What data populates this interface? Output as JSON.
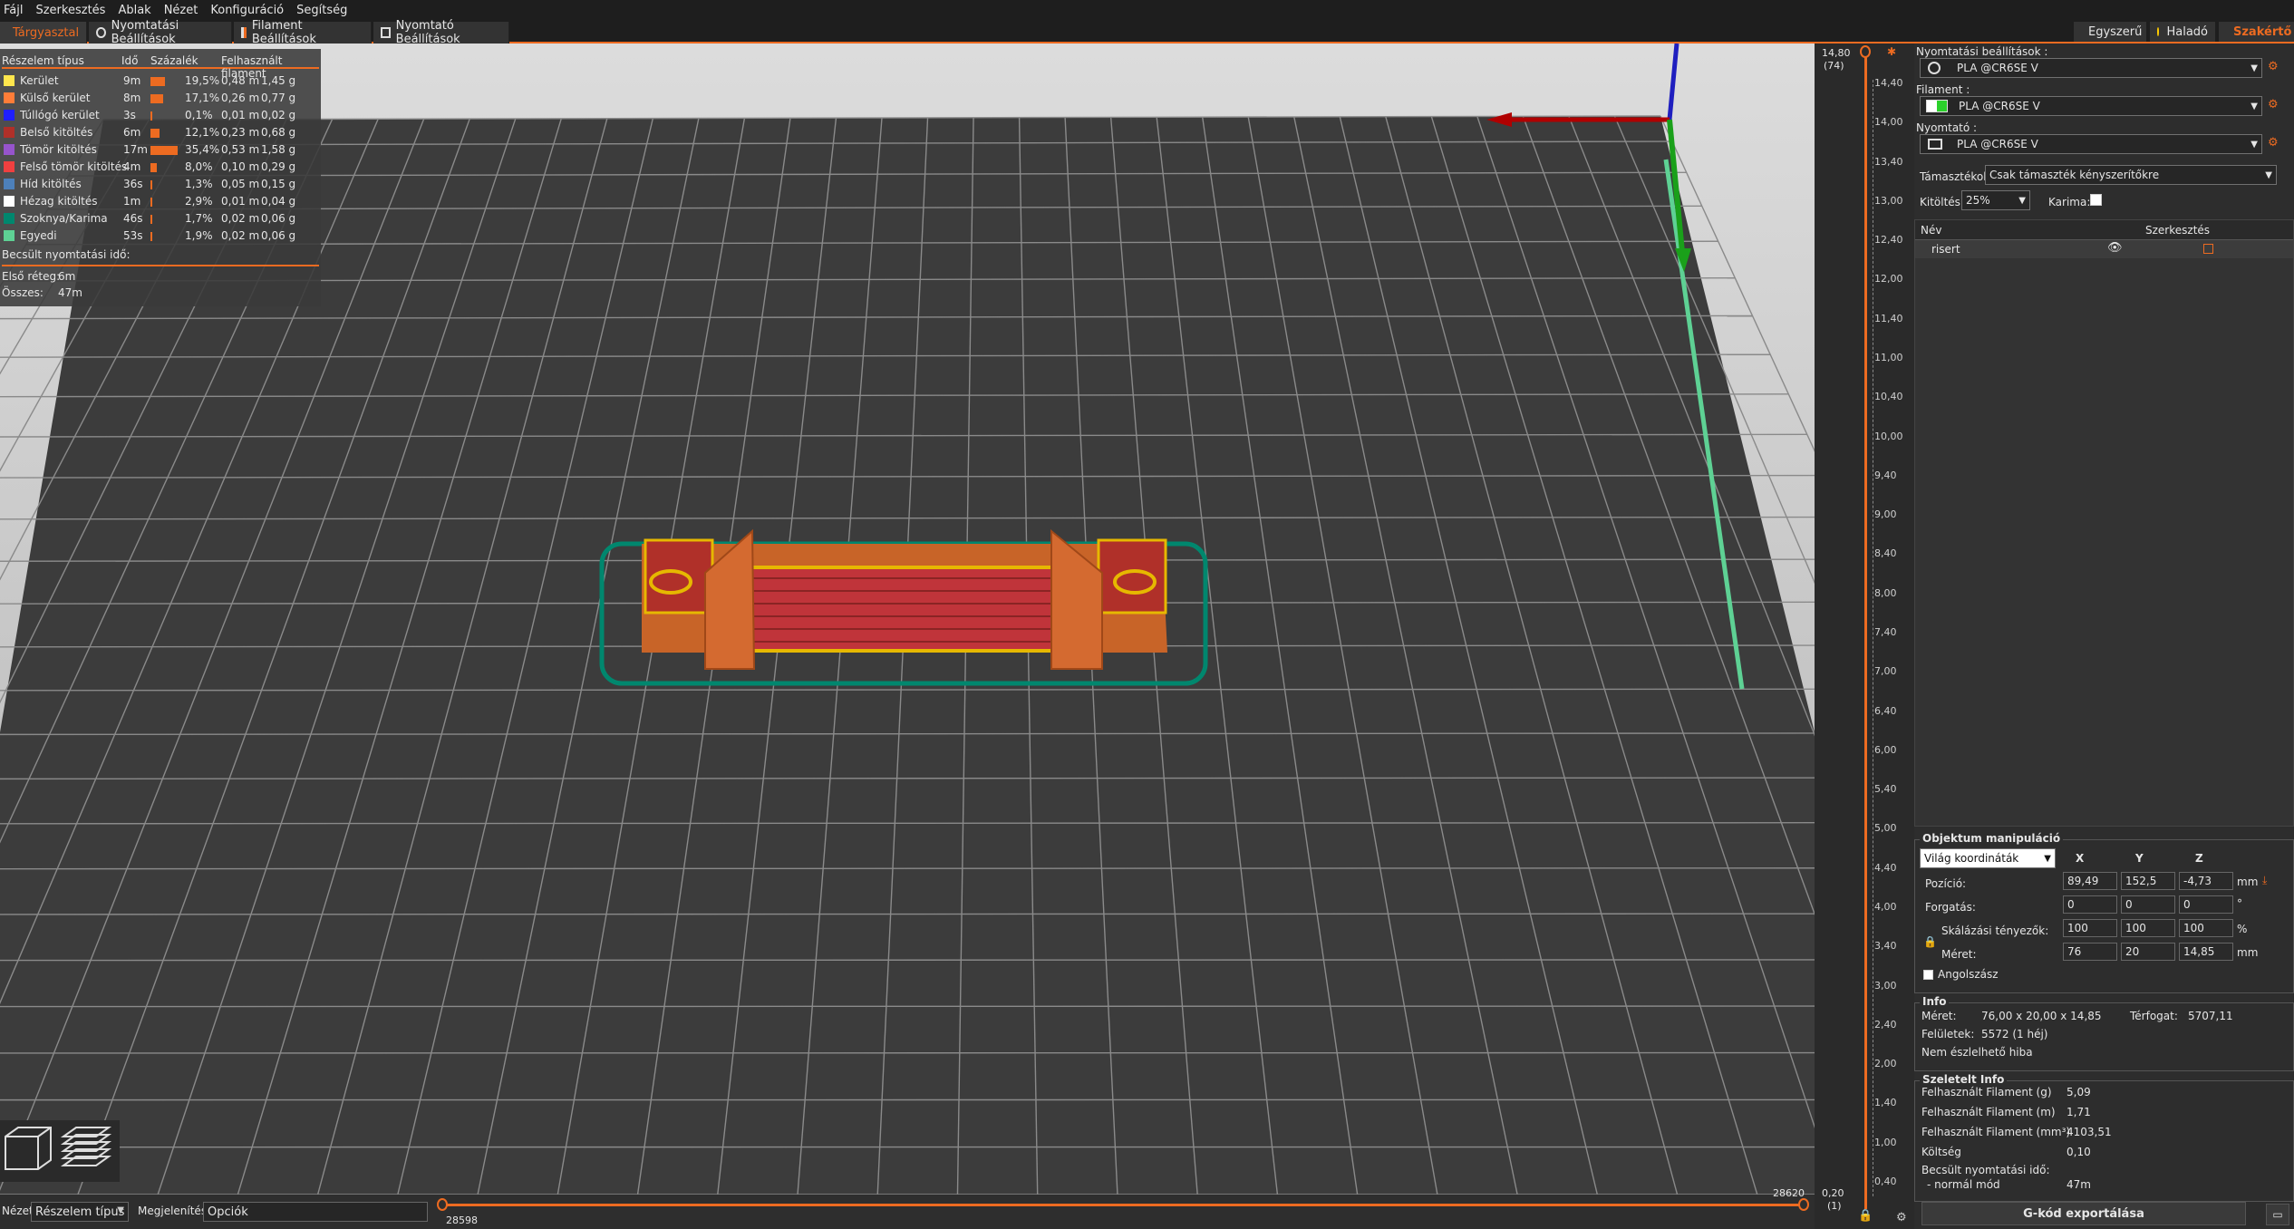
{
  "menu": [
    "Fájl",
    "Szerkesztés",
    "Ablak",
    "Nézet",
    "Konfiguráció",
    "Segítség"
  ],
  "tabs": [
    "Tárgyasztal",
    "Nyomtatási Beállítások",
    "Filament Beállítások",
    "Nyomtató Beállítások"
  ],
  "modes": [
    {
      "label": "Egyszerű",
      "color": "#22cc22"
    },
    {
      "label": "Haladó",
      "color": "#ffcc00"
    },
    {
      "label": "Szakértő",
      "color": "#e01010"
    }
  ],
  "legend": {
    "headers": [
      "Részelem típus",
      "Idő",
      "Százalék",
      "Felhasznált filament"
    ],
    "rows": [
      {
        "name": "Kerület",
        "time": "9m",
        "pct": "19,5%",
        "m": "0,48 m",
        "g": "1,45 g",
        "color": "#ffe64d",
        "bar": 0.195
      },
      {
        "name": "Külső kerület",
        "time": "8m",
        "pct": "17,1%",
        "m": "0,26 m",
        "g": "0,77 g",
        "color": "#ff7d38",
        "bar": 0.171
      },
      {
        "name": "Túllógó kerület",
        "time": "3s",
        "pct": "0,1%",
        "m": "0,01 m",
        "g": "0,02 g",
        "color": "#1f1fff",
        "bar": 0.001
      },
      {
        "name": "Belső kitöltés",
        "time": "6m",
        "pct": "12,1%",
        "m": "0,23 m",
        "g": "0,68 g",
        "color": "#b03029",
        "bar": 0.121
      },
      {
        "name": "Tömör kitöltés",
        "time": "17m",
        "pct": "35,4%",
        "m": "0,53 m",
        "g": "1,58 g",
        "color": "#9654cc",
        "bar": 0.354
      },
      {
        "name": "Felső tömör kitöltés",
        "time": "4m",
        "pct": "8,0%",
        "m": "0,10 m",
        "g": "0,29 g",
        "color": "#f04040",
        "bar": 0.08
      },
      {
        "name": "Híd kitöltés",
        "time": "36s",
        "pct": "1,3%",
        "m": "0,05 m",
        "g": "0,15 g",
        "color": "#4d80ba",
        "bar": 0.013
      },
      {
        "name": "Hézag kitöltés",
        "time": "1m",
        "pct": "2,9%",
        "m": "0,01 m",
        "g": "0,04 g",
        "color": "#ffffff",
        "bar": 0.029
      },
      {
        "name": "Szoknya/Karima",
        "time": "46s",
        "pct": "1,7%",
        "m": "0,02 m",
        "g": "0,06 g",
        "color": "#00876e",
        "bar": 0.017
      },
      {
        "name": "Egyedi",
        "time": "53s",
        "pct": "1,9%",
        "m": "0,02 m",
        "g": "0,06 g",
        "color": "#5ed194",
        "bar": 0.019
      }
    ],
    "estimate_title": "Becsült nyomtatási idő:",
    "first_layer_label": "Első réteg:",
    "first_layer_value": "6m",
    "total_label": "Összes:",
    "total_value": "47m"
  },
  "bottom": {
    "view_label": "Nézet",
    "view_value": "Részelem típus",
    "display_label": "Megjelenítés",
    "options_value": "Opciók",
    "h_left": "28598",
    "h_right": "28620"
  },
  "vslider": {
    "top_value": "14,80",
    "top_layer": "(74)",
    "bottom_value": "0,20",
    "bottom_layer": "(1)",
    "ticks": [
      "14,40",
      "14,00",
      "13,40",
      "13,00",
      "12,40",
      "12,00",
      "11,40",
      "11,00",
      "10,40",
      "10,00",
      "9,40",
      "9,00",
      "8,40",
      "8,00",
      "7,40",
      "7,00",
      "6,40",
      "6,00",
      "5,40",
      "5,00",
      "4,40",
      "4,00",
      "3,40",
      "3,00",
      "2,40",
      "2,00",
      "1,40",
      "1,00",
      "0,40"
    ]
  },
  "panel": {
    "print_settings_label": "Nyomtatási beállítások :",
    "print_settings_value": "PLA @CR6SE V",
    "filament_label": "Filament :",
    "filament_value": "PLA @CR6SE V",
    "printer_label": "Nyomtató :",
    "printer_value": "PLA @CR6SE V",
    "supports_label": "Támasztékok:",
    "supports_value": "Csak támaszték kényszerítőkre",
    "infill_label": "Kitöltés:",
    "infill_value": "25%",
    "brim_label": "Karima:",
    "list_name_header": "Név",
    "list_edit_header": "Szerkesztés",
    "object_name": "risert",
    "manip_title": "Objektum manipuláció",
    "coord_value": "Világ koordináták",
    "axis_x": "X",
    "axis_y": "Y",
    "axis_z": "Z",
    "position_label": "Pozíció:",
    "position": [
      "89,49",
      "152,5",
      "-4,73"
    ],
    "position_unit": "mm",
    "rotation_label": "Forgatás:",
    "rotation": [
      "0",
      "0",
      "0"
    ],
    "rotation_unit": "°",
    "scale_label": "Skálázási tényezők:",
    "scale": [
      "100",
      "100",
      "100"
    ],
    "scale_unit": "%",
    "size_label": "Méret:",
    "size": [
      "76",
      "20",
      "14,85"
    ],
    "size_unit": "mm",
    "inches_label": "Angolszász",
    "info_title": "Info",
    "info_size_label": "Méret:",
    "info_size_value": "76,00 x 20,00 x 14,85",
    "volume_label": "Térfogat:",
    "volume_value": "5707,11",
    "facets_label": "Felületek:",
    "facets_value": "5572 (1 héj)",
    "errors_text": "Nem észlelhető hiba",
    "sliced_title": "Szeletelt Info",
    "used_g_label": "Felhasznált Filament (g)",
    "used_g_value": "5,09",
    "used_m_label": "Felhasznált Filament (m)",
    "used_m_value": "1,71",
    "used_mm3_label": "Felhasznált Filament (mm³)",
    "used_mm3_value": "4103,51",
    "cost_label": "Költség",
    "cost_value": "0,10",
    "est_label": "Becsült nyomtatási idő:",
    "normal_label": "- normál mód",
    "normal_value": "47m",
    "export_button": "G-kód exportálása"
  }
}
